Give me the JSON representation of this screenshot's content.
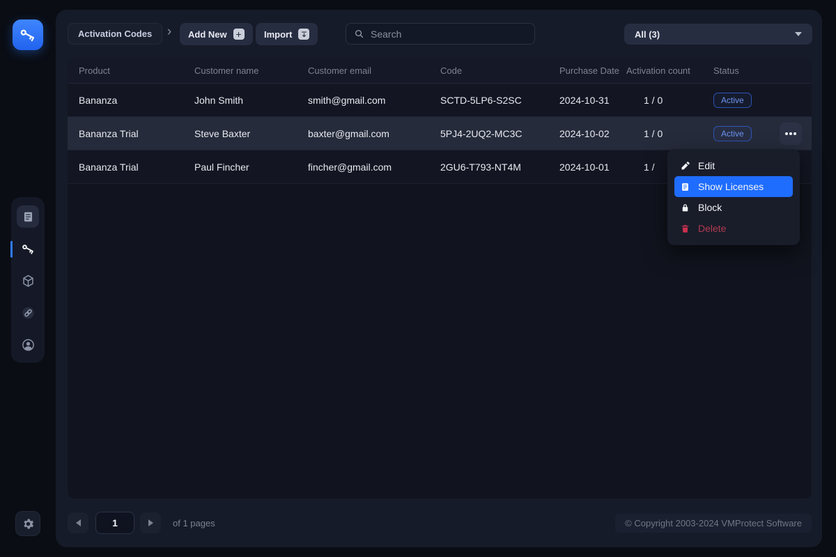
{
  "toolbar": {
    "breadcrumb_label": "Activation Codes",
    "add_new_label": "Add New",
    "import_label": "Import",
    "search_placeholder": "Search",
    "filter_value": "All (3)"
  },
  "sidebar": {
    "items": [
      {
        "name": "documents",
        "icon": "document-icon",
        "active": false
      },
      {
        "name": "activation-codes",
        "icon": "key-icon",
        "active": true
      },
      {
        "name": "products",
        "icon": "cube-icon",
        "active": false
      },
      {
        "name": "links",
        "icon": "link-icon",
        "active": false
      },
      {
        "name": "account",
        "icon": "user-icon",
        "active": false
      }
    ],
    "settings_icon": "gear-icon",
    "logo_icon": "key-icon"
  },
  "table": {
    "columns": [
      "Product",
      "Customer name",
      "Customer email",
      "Code",
      "Purchase Date",
      "Activation count",
      "Status"
    ],
    "rows": [
      {
        "product": "Bananza",
        "customer_name": "John Smith",
        "customer_email": "smith@gmail.com",
        "code": "SCTD-5LP6-S2SC",
        "purchase_date": "2024-10-31",
        "activation_count": "1 / 0",
        "status": "Active"
      },
      {
        "product": "Bananza Trial",
        "customer_name": "Steve Baxter",
        "customer_email": "baxter@gmail.com",
        "code": "5PJ4-2UQ2-MC3C",
        "purchase_date": "2024-10-02",
        "activation_count": "1 / 0",
        "status": "Active"
      },
      {
        "product": "Bananza Trial",
        "customer_name": "Paul Fincher",
        "customer_email": "fincher@gmail.com",
        "code": "2GU6-T793-NT4M",
        "purchase_date": "2024-10-01",
        "activation_count": "1 /",
        "status": null
      }
    ]
  },
  "context_menu": {
    "items": [
      {
        "label": "Edit",
        "icon": "pencil-icon",
        "style": "normal"
      },
      {
        "label": "Show Licenses",
        "icon": "license-icon",
        "style": "selected"
      },
      {
        "label": "Block",
        "icon": "lock-icon",
        "style": "normal"
      },
      {
        "label": "Delete",
        "icon": "trash-icon",
        "style": "danger"
      }
    ]
  },
  "pagination": {
    "page_value": "1",
    "pages_label": "of 1 pages"
  },
  "footer": {
    "copyright": "© Copyright 2003-2024 VMProtect Software"
  },
  "colors": {
    "accent_blue": "#2f7bff",
    "menu_highlight": "#1f6dff",
    "active_badge_text": "#6d93ef",
    "danger_red": "#c7304d",
    "background": "#0a0d14",
    "card_background": "#161b29"
  }
}
